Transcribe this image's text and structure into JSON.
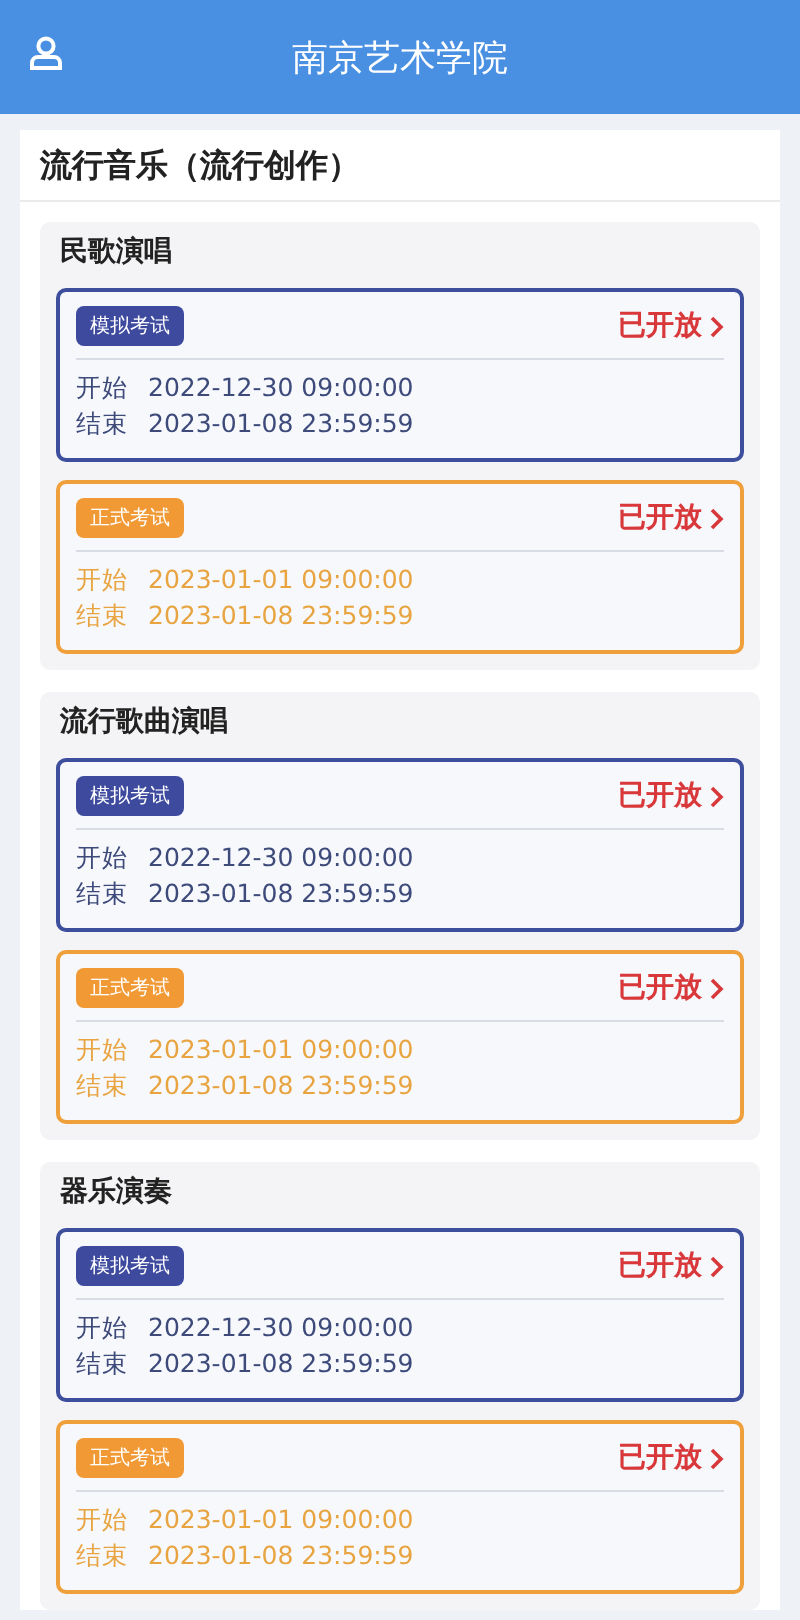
{
  "header": {
    "title": "南京艺术学院"
  },
  "section": {
    "title": "流行音乐（流行创作）"
  },
  "groups": [
    {
      "title": "民歌演唱",
      "exams": [
        {
          "kind": "mock",
          "tag": "模拟考试",
          "status": "已开放",
          "start_label": "开始",
          "start": "2022-12-30 09:00:00",
          "end_label": "结束",
          "end": "2023-01-08 23:59:59"
        },
        {
          "kind": "formal",
          "tag": "正式考试",
          "status": "已开放",
          "start_label": "开始",
          "start": "2023-01-01 09:00:00",
          "end_label": "结束",
          "end": "2023-01-08 23:59:59"
        }
      ]
    },
    {
      "title": "流行歌曲演唱",
      "exams": [
        {
          "kind": "mock",
          "tag": "模拟考试",
          "status": "已开放",
          "start_label": "开始",
          "start": "2022-12-30 09:00:00",
          "end_label": "结束",
          "end": "2023-01-08 23:59:59"
        },
        {
          "kind": "formal",
          "tag": "正式考试",
          "status": "已开放",
          "start_label": "开始",
          "start": "2023-01-01 09:00:00",
          "end_label": "结束",
          "end": "2023-01-08 23:59:59"
        }
      ]
    },
    {
      "title": "器乐演奏",
      "exams": [
        {
          "kind": "mock",
          "tag": "模拟考试",
          "status": "已开放",
          "start_label": "开始",
          "start": "2022-12-30 09:00:00",
          "end_label": "结束",
          "end": "2023-01-08 23:59:59"
        },
        {
          "kind": "formal",
          "tag": "正式考试",
          "status": "已开放",
          "start_label": "开始",
          "start": "2023-01-01 09:00:00",
          "end_label": "结束",
          "end": "2023-01-08 23:59:59"
        }
      ]
    }
  ]
}
